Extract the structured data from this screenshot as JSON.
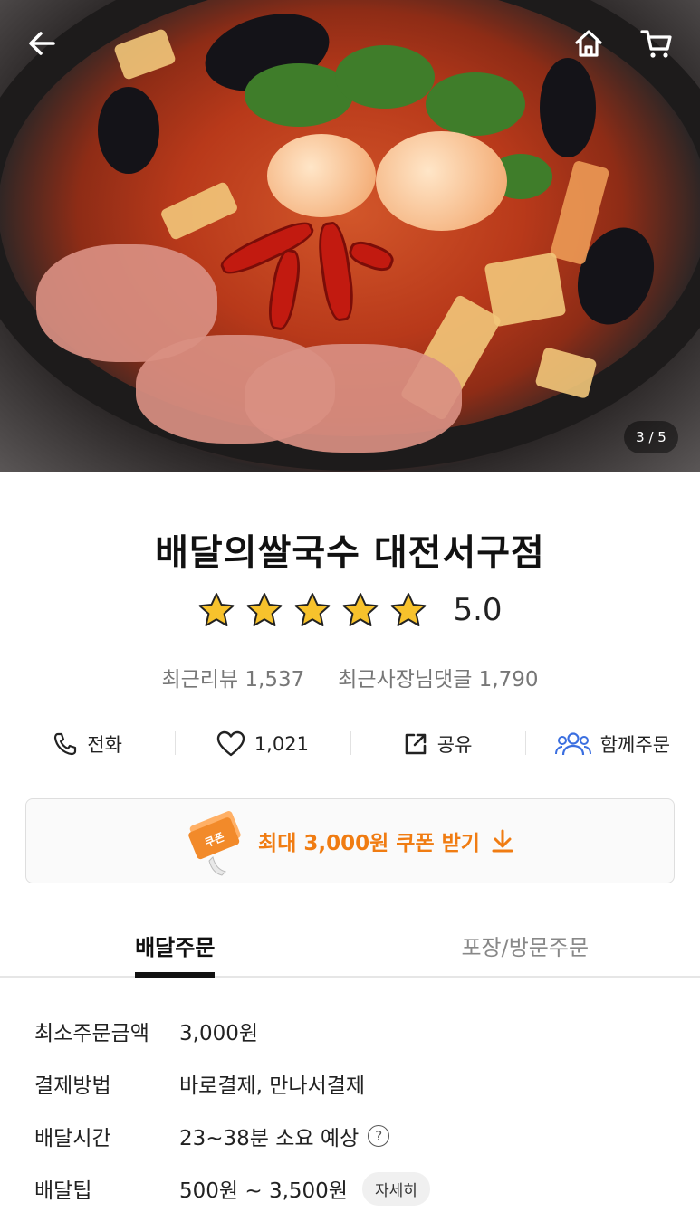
{
  "header": {
    "back_icon": "arrow-left-icon",
    "home_icon": "home-icon",
    "cart_icon": "cart-icon",
    "image_counter": "3 / 5"
  },
  "store": {
    "name": "배달의쌀국수 대전서구점",
    "rating": "5.0",
    "rating_value": 5,
    "max_rating": 5,
    "star_color": "#f7c22c",
    "reviews_label": "최근리뷰 1,537",
    "owner_replies_label": "최근사장님댓글 1,790"
  },
  "actions": [
    {
      "icon": "phone-icon",
      "label": "전화"
    },
    {
      "icon": "heart-icon",
      "label": "1,021"
    },
    {
      "icon": "share-icon",
      "label": "공유"
    },
    {
      "icon": "group-icon",
      "label": "함께주문",
      "color": "#3b6fe0"
    }
  ],
  "coupon": {
    "badge": "쿠폰",
    "label": "최대 3,000원 쿠폰 받기",
    "accent": "#f07c12"
  },
  "tabs": [
    {
      "label": "배달주문",
      "active": true
    },
    {
      "label": "포장/방문주문",
      "active": false
    }
  ],
  "info": {
    "min_order": {
      "key": "최소주문금액",
      "value": "3,000원"
    },
    "payment": {
      "key": "결제방법",
      "value": "바로결제, 만나서결제"
    },
    "delivery_time": {
      "key": "배달시간",
      "value": "23~38분 소요 예상",
      "help": "?"
    },
    "delivery_tip": {
      "key": "배달팁",
      "value": "500원 ~ 3,500원",
      "detail": "자세히"
    }
  }
}
